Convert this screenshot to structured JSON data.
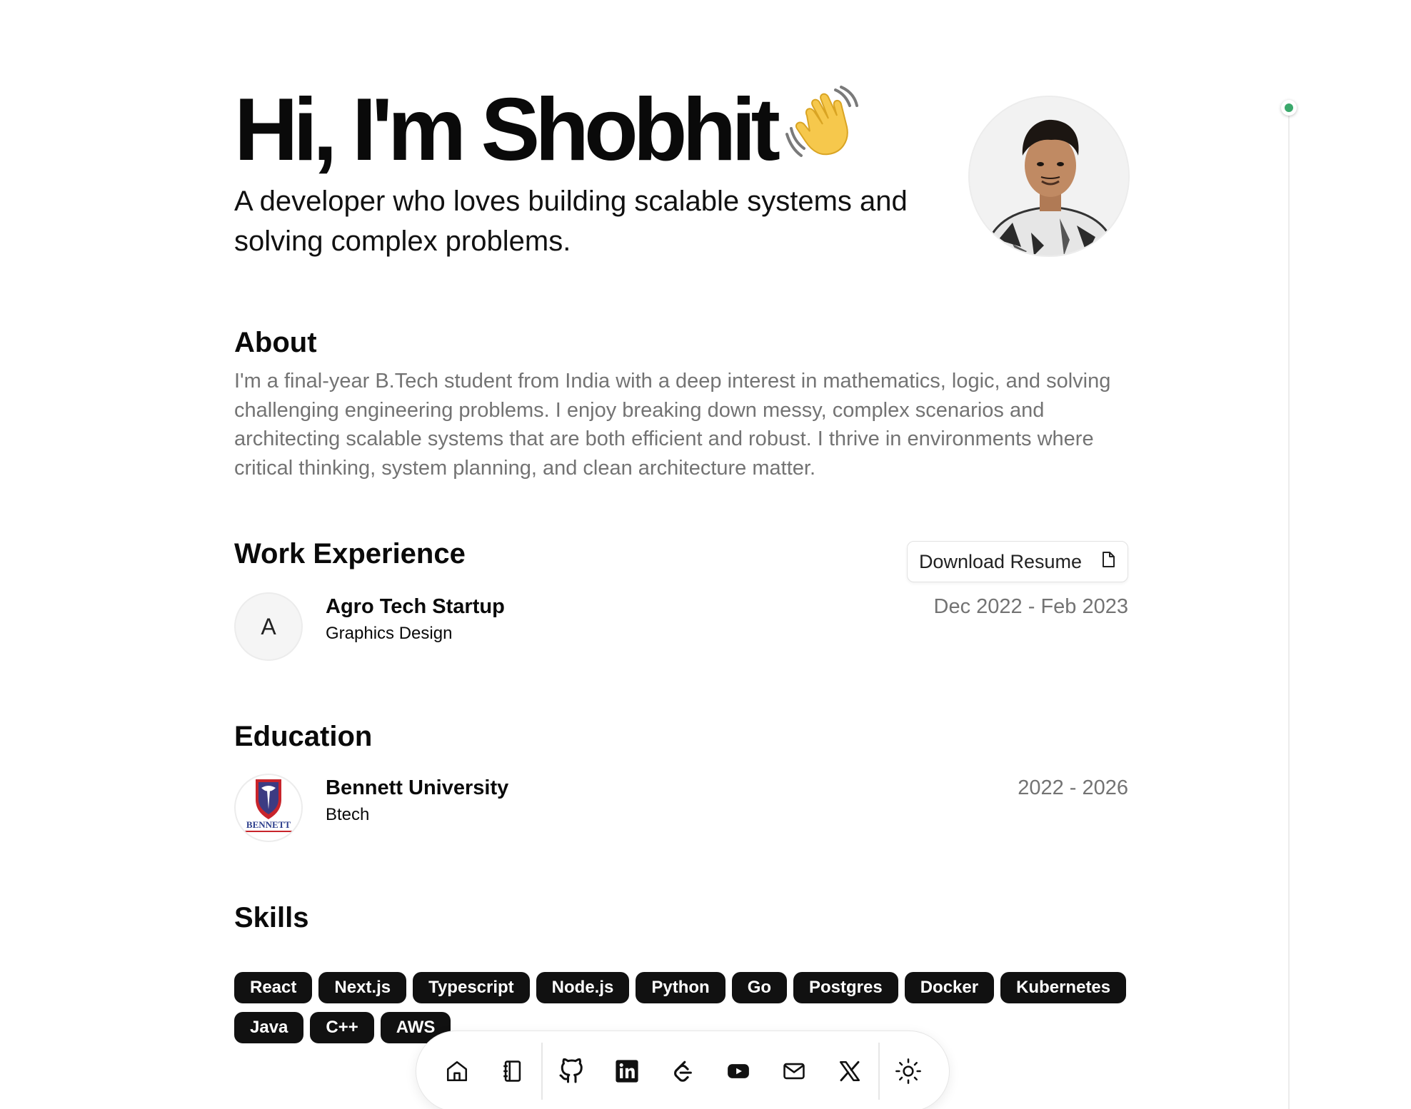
{
  "hero": {
    "title": "Hi, I'm Shobhit",
    "wave_emoji": "👋",
    "subtitle": "A developer who loves building scalable systems and solving complex problems."
  },
  "about": {
    "heading": "About",
    "text": "I'm a final-year B.Tech student from India with a deep interest in mathematics, logic, and solving challenging engineering problems. I enjoy breaking down messy, complex scenarios and architecting scalable systems that are both efficient and robust. I thrive in environments where critical thinking, system planning, and clean architecture matter."
  },
  "work": {
    "heading": "Work Experience",
    "resume_label": "Download Resume",
    "entries": [
      {
        "logo_letter": "A",
        "company": "Agro Tech Startup",
        "role": "Graphics Design",
        "dates": "Dec 2022 - Feb 2023"
      }
    ]
  },
  "education": {
    "heading": "Education",
    "entries": [
      {
        "school": "Bennett University",
        "degree": "Btech",
        "dates": "2022 - 2026",
        "logo_text": "BENNETT"
      }
    ]
  },
  "skills": {
    "heading": "Skills",
    "items": [
      "React",
      "Next.js",
      "Typescript",
      "Node.js",
      "Python",
      "Go",
      "Postgres",
      "Docker",
      "Kubernetes",
      "Java",
      "C++",
      "AWS"
    ]
  },
  "dock": {
    "items": [
      "home-icon",
      "notebook-icon",
      "github-icon",
      "linkedin-icon",
      "leetcode-icon",
      "youtube-icon",
      "mail-icon",
      "x-icon",
      "sun-icon"
    ]
  },
  "colors": {
    "accent_dot": "#3aa86b",
    "chip_bg": "#111111",
    "muted_text": "#737373"
  }
}
